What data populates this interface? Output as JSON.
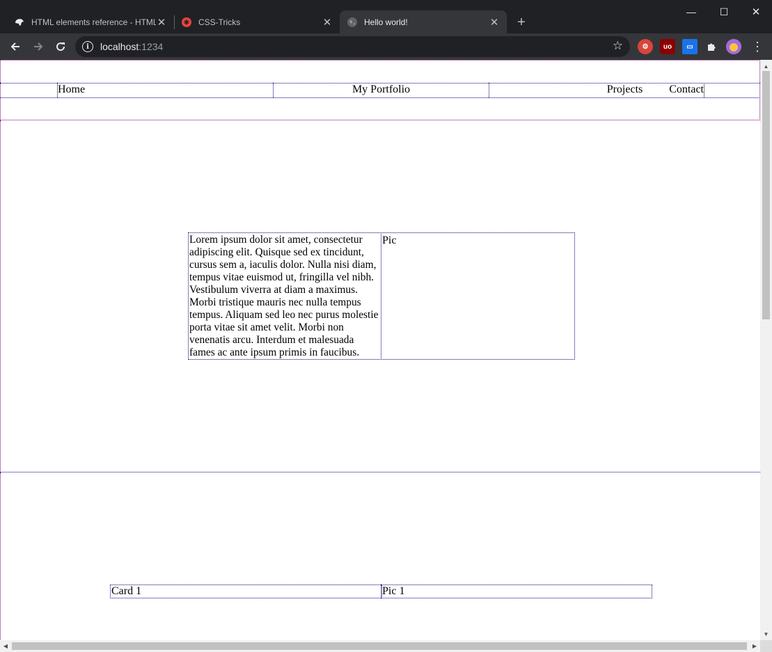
{
  "browser": {
    "tabs": [
      {
        "title": "HTML elements reference - HTML",
        "favicon": "mdn-icon"
      },
      {
        "title": "CSS-Tricks",
        "favicon": "css-tricks-icon"
      },
      {
        "title": "Hello world!",
        "favicon": "globe-icon",
        "active": true
      }
    ],
    "url_host": "localhost",
    "url_port": ":1234",
    "window_controls": {
      "minimize": "—",
      "maximize": "☐",
      "close": "✕"
    }
  },
  "page": {
    "nav": {
      "home": "Home",
      "brand": "My Portfolio",
      "projects": "Projects",
      "contact": "Contact"
    },
    "hero": {
      "text": "Lorem ipsum dolor sit amet, consectetur adipiscing elit. Quisque sed ex tincidunt, cursus sem a, iaculis dolor. Nulla nisi diam, tempus vitae euismod ut, fringilla vel nibh. Vestibulum viverra at diam a maximus. Morbi tristique mauris nec nulla tempus tempus. Aliquam sed leo nec purus molestie porta vitae sit amet velit. Morbi non venenatis arcu. Interdum et malesuada fames ac ante ipsum primis in faucibus.",
      "pic": "Pic"
    },
    "cards": [
      {
        "title": "Card 1",
        "pic": "Pic 1"
      }
    ]
  },
  "colors": {
    "chrome_dark": "#202124",
    "chrome_toolbar": "#35363a",
    "outline_purple": "#800080",
    "outline_navy": "#000080"
  }
}
